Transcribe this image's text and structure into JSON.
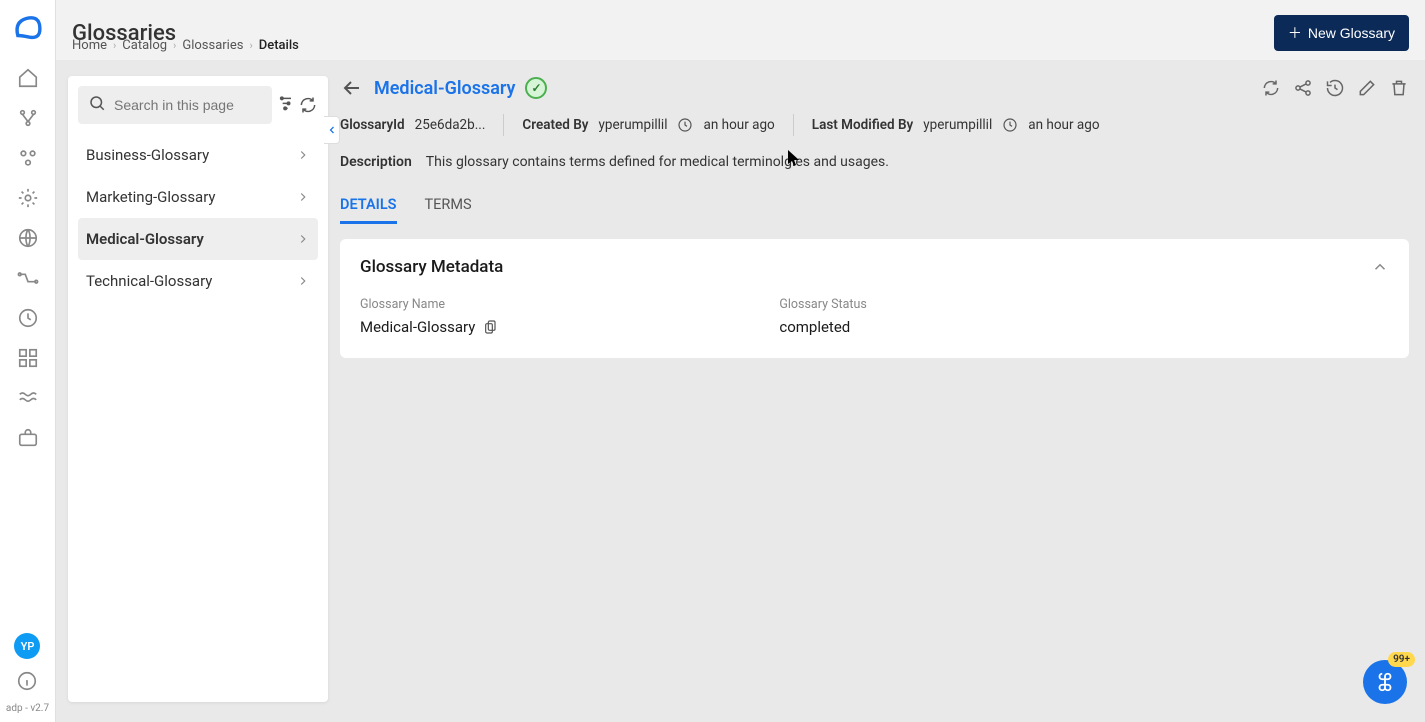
{
  "page": {
    "title": "Glossaries"
  },
  "breadcrumbs": [
    "Home",
    "Catalog",
    "Glossaries",
    "Details"
  ],
  "newButton": {
    "label": "New Glossary"
  },
  "search": {
    "placeholder": "Search in this page"
  },
  "sidebarGlossaries": [
    {
      "name": "Business-Glossary",
      "active": false
    },
    {
      "name": "Marketing-Glossary",
      "active": false
    },
    {
      "name": "Medical-Glossary",
      "active": true
    },
    {
      "name": "Technical-Glossary",
      "active": false
    }
  ],
  "detail": {
    "title": "Medical-Glossary",
    "idLabel": "GlossaryId",
    "idValue": "25e6da2b...",
    "createdByLabel": "Created By",
    "createdByUser": "yperumpillil",
    "createdByTime": "an hour ago",
    "modifiedByLabel": "Last Modified By",
    "modifiedByUser": "yperumpillil",
    "modifiedByTime": "an hour ago",
    "descriptionLabel": "Description",
    "descriptionValue": "This glossary contains terms defined for medical terminolgies and usages."
  },
  "tabs": {
    "details": "DETAILS",
    "terms": "TERMS"
  },
  "card": {
    "title": "Glossary Metadata",
    "nameLabel": "Glossary Name",
    "nameValue": "Medical-Glossary",
    "statusLabel": "Glossary Status",
    "statusValue": "completed"
  },
  "rail": {
    "avatar": "YP",
    "version": "adp - v2.7"
  },
  "fab": {
    "badge": "99+"
  }
}
